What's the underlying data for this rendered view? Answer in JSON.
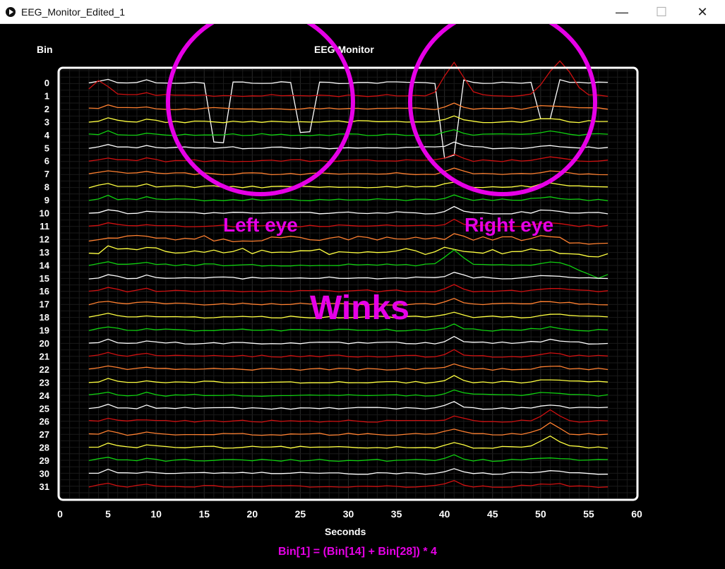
{
  "window": {
    "title": "EEG_Monitor_Edited_1",
    "minimize_glyph": "—",
    "maximize_glyph": "☐",
    "close_glyph": "✕"
  },
  "chart": {
    "title": "EEG Monitor",
    "y_label": "Bin",
    "x_label": "Seconds",
    "formula": "Bin[1] = (Bin[14] + Bin[28]) * 4"
  },
  "annotations": {
    "left_eye": "Left eye",
    "right_eye": "Right eye",
    "winks": "Winks",
    "color": "#e600e6"
  },
  "chart_data": {
    "type": "line",
    "xlabel": "Seconds",
    "ylabel": "Bin",
    "x_ticks": [
      0,
      5,
      10,
      15,
      20,
      25,
      30,
      35,
      40,
      45,
      50,
      55,
      60
    ],
    "bins": [
      0,
      1,
      2,
      3,
      4,
      5,
      6,
      7,
      8,
      9,
      10,
      11,
      12,
      13,
      14,
      15,
      16,
      17,
      18,
      19,
      20,
      21,
      22,
      23,
      24,
      25,
      26,
      27,
      28,
      29,
      30,
      31
    ],
    "xlim": [
      0,
      60
    ],
    "x_start": 3,
    "x_end": 57,
    "series_colors": [
      "#ffffff",
      "#d01010",
      "#ff8030",
      "#ffff40",
      "#10d010"
    ],
    "grid": true
  }
}
